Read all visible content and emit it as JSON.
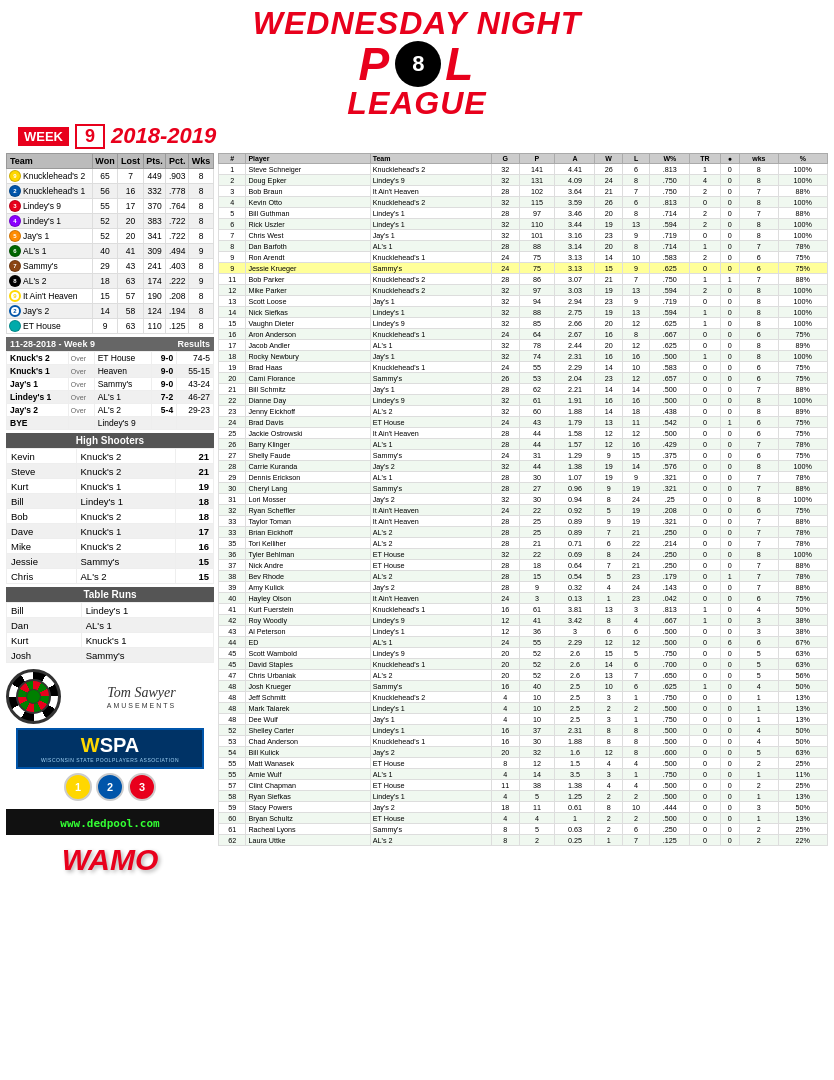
{
  "header": {
    "line1": "WEDNESDAY NIGHT",
    "line2": "P  L LEAGUE",
    "week_label": "WEEK",
    "week_num": "9",
    "year": "2018-2019"
  },
  "standings": {
    "title": "Team",
    "headers": [
      "Team",
      "Won",
      "Lost",
      "Pts.",
      "Pct.",
      "Wks"
    ],
    "rows": [
      {
        "ball_color": "#FFD700",
        "ball_num": "9",
        "solid": true,
        "team": "Knucklehead's 2",
        "won": 65,
        "lost": 7,
        "pts": 449,
        "pct": ".903",
        "wks": 8
      },
      {
        "ball_color": "#0055AA",
        "ball_num": "2",
        "solid": true,
        "team": "Knucklehead's 1",
        "won": 56,
        "lost": 16,
        "pts": 332,
        "pct": ".778",
        "wks": 8
      },
      {
        "ball_color": "#e8001c",
        "ball_num": "3",
        "solid": true,
        "team": "Lindey's 9",
        "won": 55,
        "lost": 17,
        "pts": 370,
        "pct": ".764",
        "wks": 8
      },
      {
        "ball_color": "#8B00FF",
        "ball_num": "4",
        "solid": true,
        "team": "Lindey's 1",
        "won": 52,
        "lost": 20,
        "pts": 383,
        "pct": ".722",
        "wks": 8
      },
      {
        "ball_color": "#FF8C00",
        "ball_num": "5",
        "solid": true,
        "team": "Jay's 1",
        "won": 52,
        "lost": 20,
        "pts": 341,
        "pct": ".722",
        "wks": 8
      },
      {
        "ball_color": "#006600",
        "ball_num": "6",
        "solid": true,
        "team": "AL's 1",
        "won": 40,
        "lost": 41,
        "pts": 309,
        "pct": ".494",
        "wks": 9
      },
      {
        "ball_color": "#8B4513",
        "ball_num": "7",
        "solid": true,
        "team": "Sammy's",
        "won": 29,
        "lost": 43,
        "pts": 241,
        "pct": ".403",
        "wks": 8
      },
      {
        "ball_color": "#000000",
        "ball_num": "8",
        "solid": true,
        "team": "AL's 2",
        "won": 18,
        "lost": 63,
        "pts": 174,
        "pct": ".222",
        "wks": 9
      },
      {
        "ball_color": "#FFD700",
        "ball_num": "9",
        "solid": false,
        "team": "It Ain't Heaven",
        "won": 15,
        "lost": 57,
        "pts": 190,
        "pct": ".208",
        "wks": 8
      },
      {
        "ball_color": "#0055AA",
        "ball_num": "2",
        "solid": false,
        "team": "Jay's 2",
        "won": 14,
        "lost": 58,
        "pts": 124,
        "pct": ".194",
        "wks": 8
      },
      {
        "ball_color": "#00AAAA",
        "ball_num": "",
        "solid": true,
        "team": "ET House",
        "won": 9,
        "lost": 63,
        "pts": 110,
        "pct": ".125",
        "wks": 8
      }
    ]
  },
  "week_results": {
    "title": "11-28-2018 - Week 9",
    "results_label": "Results",
    "rows": [
      {
        "team1": "Knuck's 2",
        "over": "Over",
        "team2": "ET House",
        "score1": "9-0",
        "score2": "74-5"
      },
      {
        "team1": "Knuck's 1",
        "over": "Over",
        "team2": "Heaven",
        "score1": "9-0",
        "score2": "55-15"
      },
      {
        "team1": "Jay's 1",
        "over": "Over",
        "team2": "Sammy's",
        "score1": "9-0",
        "score2": "43-24"
      },
      {
        "team1": "Lindey's 1",
        "over": "Over",
        "team2": "AL's 1",
        "score1": "7-2",
        "score2": "46-27"
      },
      {
        "team1": "Jay's 2",
        "over": "Over",
        "team2": "AL's 2",
        "score1": "5-4",
        "score2": "29-23"
      },
      {
        "team1": "BYE",
        "over": "",
        "team2": "Lindey's 9",
        "score1": "",
        "score2": ""
      }
    ]
  },
  "high_shooters": {
    "title": "High Shooters",
    "rows": [
      {
        "name": "Kevin",
        "team": "Knuck's 2",
        "score": 21
      },
      {
        "name": "Steve",
        "team": "Knuck's 2",
        "score": 21
      },
      {
        "name": "Kurt",
        "team": "Knuck's 1",
        "score": 19
      },
      {
        "name": "Bill",
        "team": "Lindey's 1",
        "score": 18
      },
      {
        "name": "Bob",
        "team": "Knuck's 2",
        "score": 18
      },
      {
        "name": "Dave",
        "team": "Knuck's 1",
        "score": 17
      },
      {
        "name": "Mike",
        "team": "Knuck's 2",
        "score": 16
      },
      {
        "name": "Jessie",
        "team": "Sammy's",
        "score": 15
      },
      {
        "name": "Chris",
        "team": "AL's 2",
        "score": 15
      }
    ]
  },
  "table_runs": {
    "title": "Table Runs",
    "rows": [
      {
        "name": "Bill",
        "team": "Lindey's 1"
      },
      {
        "name": "Dan",
        "team": "AL's 1"
      },
      {
        "name": "Kurt",
        "team": "Knuck's 1"
      },
      {
        "name": "Josh",
        "team": "Sammy's"
      }
    ]
  },
  "logos": {
    "tom_sawyer": "Tom Sawyer",
    "tom_sawyer_sub": "AMUSEMENTS",
    "wspa": "WSPA",
    "wspa_full": "WISCONSIN STATE POOLPLAYERS ASSOCIATION",
    "dedpool": "www.dedpool.com",
    "wamo": "WAMO"
  },
  "stats": {
    "headers": [
      "#",
      "Player",
      "Team",
      "G",
      "P",
      "A",
      "W",
      "L",
      "W%",
      "TR",
      "●",
      "wks",
      "%"
    ],
    "rows": [
      [
        1,
        "Steve Schneiger",
        "Knucklehead's 2",
        32,
        141,
        4.41,
        26,
        6,
        ".813",
        1,
        0,
        8,
        "100%"
      ],
      [
        2,
        "Doug Epker",
        "Lindey's 9",
        32,
        131,
        4.09,
        24,
        8,
        ".750",
        4,
        0,
        8,
        "100%"
      ],
      [
        3,
        "Bob Braun",
        "It Ain't Heaven",
        28,
        102,
        3.64,
        21,
        7,
        ".750",
        2,
        0,
        7,
        "88%"
      ],
      [
        4,
        "Kevin Otto",
        "Knucklehead's 2",
        32,
        115,
        3.59,
        26,
        6,
        ".813",
        0,
        0,
        8,
        "100%"
      ],
      [
        5,
        "Bill Guthman",
        "Lindey's 1",
        28,
        97,
        3.46,
        20,
        8,
        ".714",
        2,
        0,
        7,
        "88%"
      ],
      [
        6,
        "Rick Uszler",
        "Lindey's 1",
        32,
        110,
        3.44,
        19,
        13,
        ".594",
        2,
        0,
        8,
        "100%"
      ],
      [
        7,
        "Chris West",
        "Jay's 1",
        32,
        101,
        3.16,
        23,
        9,
        ".719",
        0,
        0,
        8,
        "100%"
      ],
      [
        8,
        "Dan Barfoth",
        "AL's 1",
        28,
        88,
        3.14,
        20,
        8,
        ".714",
        1,
        0,
        7,
        "78%"
      ],
      [
        9,
        "Ron Arendt",
        "Knucklehead's 1",
        24,
        75,
        3.13,
        14,
        10,
        ".583",
        2,
        0,
        6,
        "75%"
      ],
      [
        9,
        "Jessie Krueger",
        "Sammy's",
        24,
        75,
        3.13,
        15,
        9,
        ".625",
        0,
        0,
        6,
        "75%"
      ],
      [
        11,
        "Bob Parker",
        "Knucklehead's 2",
        28,
        86,
        3.07,
        21,
        7,
        ".750",
        1,
        1,
        7,
        "88%"
      ],
      [
        12,
        "Mike Parker",
        "Knucklehead's 2",
        32,
        97,
        3.03,
        19,
        13,
        ".594",
        2,
        0,
        8,
        "100%"
      ],
      [
        13,
        "Scott Loose",
        "Jay's 1",
        32,
        94,
        2.94,
        23,
        9,
        ".719",
        0,
        0,
        8,
        "100%"
      ],
      [
        14,
        "Nick Siefkas",
        "Lindey's 1",
        32,
        88,
        2.75,
        19,
        13,
        ".594",
        1,
        0,
        8,
        "100%"
      ],
      [
        15,
        "Vaughn Dieter",
        "Lindey's 9",
        32,
        85,
        2.66,
        20,
        12,
        ".625",
        1,
        0,
        8,
        "100%"
      ],
      [
        16,
        "Aron Anderson",
        "Knucklehead's 1",
        24,
        64,
        2.67,
        16,
        8,
        ".667",
        0,
        0,
        6,
        "75%"
      ],
      [
        17,
        "Jacob Andler",
        "AL's 1",
        32,
        78,
        2.44,
        20,
        12,
        ".625",
        0,
        0,
        8,
        "89%"
      ],
      [
        18,
        "Rocky Newbury",
        "Jay's 1",
        32,
        74,
        2.31,
        16,
        16,
        ".500",
        1,
        0,
        8,
        "100%"
      ],
      [
        19,
        "Brad Haas",
        "Knucklehead's 1",
        24,
        55,
        2.29,
        14,
        10,
        ".583",
        0,
        0,
        6,
        "75%"
      ],
      [
        20,
        "Cami Florance",
        "Sammy's",
        26,
        53,
        2.04,
        23,
        12,
        ".657",
        0,
        0,
        6,
        "75%"
      ],
      [
        21,
        "Bill Schmitz",
        "Jay's 1",
        28,
        62,
        2.21,
        14,
        14,
        ".500",
        0,
        0,
        7,
        "88%"
      ],
      [
        22,
        "Dianne Day",
        "Lindey's 9",
        32,
        61,
        1.91,
        16,
        16,
        ".500",
        0,
        0,
        8,
        "100%"
      ],
      [
        23,
        "Jenny Eickhoff",
        "AL's 2",
        32,
        60,
        1.88,
        14,
        18,
        ".438",
        0,
        0,
        8,
        "89%"
      ],
      [
        24,
        "Brad Davis",
        "ET House",
        24,
        43,
        1.79,
        13,
        11,
        ".542",
        0,
        1,
        6,
        "75%"
      ],
      [
        25,
        "Jackie Ostrowski",
        "It Ain't Heaven",
        28,
        44,
        1.58,
        12,
        12,
        ".500",
        0,
        0,
        6,
        "75%"
      ],
      [
        26,
        "Barry Klinger",
        "AL's 1",
        28,
        44,
        1.57,
        12,
        16,
        ".429",
        0,
        0,
        7,
        "78%"
      ],
      [
        27,
        "Shelly Faude",
        "Sammy's",
        24,
        31,
        1.29,
        9,
        15,
        ".375",
        0,
        0,
        6,
        "75%"
      ],
      [
        28,
        "Carrie Kuranda",
        "Jay's 2",
        32,
        44,
        1.38,
        19,
        14,
        ".576",
        0,
        0,
        8,
        "100%"
      ],
      [
        29,
        "Dennis Erickson",
        "AL's 1",
        28,
        30,
        1.07,
        19,
        9,
        ".321",
        0,
        0,
        7,
        "78%"
      ],
      [
        30,
        "Cheryl Lang",
        "Sammy's",
        28,
        27,
        0.96,
        9,
        19,
        ".321",
        0,
        0,
        7,
        "88%"
      ],
      [
        31,
        "Lori Mosser",
        "Jay's 2",
        32,
        30,
        0.94,
        8,
        24,
        ".25",
        0,
        0,
        8,
        "100%"
      ],
      [
        32,
        "Ryan Scheffler",
        "It Ain't Heaven",
        24,
        22,
        0.92,
        5,
        19,
        ".208",
        0,
        0,
        6,
        "75%"
      ],
      [
        33,
        "Taylor Toman",
        "It Ain't Heaven",
        28,
        25,
        0.89,
        9,
        19,
        ".321",
        0,
        0,
        7,
        "88%"
      ],
      [
        33,
        "Brian Eickhoff",
        "AL's 2",
        28,
        25,
        0.89,
        7,
        21,
        ".250",
        0,
        0,
        7,
        "78%"
      ],
      [
        35,
        "Tori Kelliher",
        "AL's 2",
        28,
        21,
        0.71,
        6,
        22,
        ".214",
        0,
        0,
        7,
        "78%"
      ],
      [
        36,
        "Tyler Behlman",
        "ET House",
        32,
        22,
        0.69,
        8,
        24,
        ".250",
        0,
        0,
        8,
        "100%"
      ],
      [
        37,
        "Nick Andre",
        "ET House",
        28,
        18,
        0.64,
        7,
        21,
        ".250",
        0,
        0,
        7,
        "88%"
      ],
      [
        38,
        "Bev Rhode",
        "AL's 2",
        28,
        15,
        0.54,
        5,
        23,
        ".179",
        0,
        1,
        7,
        "78%"
      ],
      [
        39,
        "Amy Kulick",
        "Jay's 2",
        28,
        9,
        0.32,
        4,
        24,
        ".143",
        0,
        0,
        7,
        "88%"
      ],
      [
        40,
        "Hayley Olson",
        "It Ain't Heaven",
        24,
        3,
        0.13,
        1,
        23,
        ".042",
        0,
        0,
        6,
        "75%"
      ],
      [
        41,
        "Kurt Fuerstein",
        "Knucklehead's 1",
        16,
        61,
        3.81,
        13,
        3,
        ".813",
        1,
        0,
        4,
        "50%"
      ],
      [
        42,
        "Roy Woodly",
        "Lindey's 9",
        12,
        41,
        3.42,
        8,
        4,
        ".667",
        1,
        0,
        3,
        "38%"
      ],
      [
        43,
        "Al Peterson",
        "Lindey's 1",
        12,
        36,
        3.0,
        6,
        6,
        ".500",
        0,
        0,
        3,
        "38%"
      ],
      [
        44,
        "ED",
        "AL's 1",
        24,
        55,
        2.29,
        12,
        12,
        ".500",
        0,
        6,
        6,
        "67%"
      ],
      [
        45,
        "Scott Wambold",
        "Lindey's 9",
        20,
        52,
        2.6,
        15,
        5,
        ".750",
        0,
        0,
        5,
        "63%"
      ],
      [
        45,
        "David Staples",
        "Knucklehead's 1",
        20,
        52,
        2.6,
        14,
        6,
        ".700",
        0,
        0,
        5,
        "63%"
      ],
      [
        47,
        "Chris Urbaniak",
        "AL's 2",
        20,
        52,
        2.6,
        13,
        7,
        ".650",
        0,
        0,
        5,
        "56%"
      ],
      [
        48,
        "Josh Krueger",
        "Sammy's",
        16,
        40,
        2.5,
        10,
        6,
        ".625",
        1,
        0,
        4,
        "50%"
      ],
      [
        48,
        "Jeff Schmitt",
        "Knucklehead's 2",
        4,
        10,
        2.5,
        3,
        1,
        ".750",
        0,
        0,
        1,
        "13%"
      ],
      [
        48,
        "Mark Talarek",
        "Lindey's 1",
        4,
        10,
        2.5,
        2,
        2,
        ".500",
        0,
        0,
        1,
        "13%"
      ],
      [
        48,
        "Dee Wulf",
        "Jay's 1",
        4,
        10,
        2.5,
        3,
        1,
        ".750",
        0,
        0,
        1,
        "13%"
      ],
      [
        52,
        "Shelley Carter",
        "Lindey's 1",
        16,
        37,
        2.31,
        8,
        8,
        ".500",
        0,
        0,
        4,
        "50%"
      ],
      [
        53,
        "Chad Anderson",
        "Knucklehead's 1",
        16,
        30,
        1.88,
        8,
        8,
        ".500",
        0,
        0,
        4,
        "50%"
      ],
      [
        54,
        "Bill Kulick",
        "Jay's 2",
        20,
        32,
        1.6,
        12,
        8,
        ".600",
        0,
        0,
        5,
        "63%"
      ],
      [
        55,
        "Matt Wanasek",
        "ET House",
        8,
        12,
        1.5,
        4,
        4,
        ".500",
        0,
        0,
        2,
        "25%"
      ],
      [
        55,
        "Arnie Wulf",
        "AL's 1",
        4,
        14,
        3.5,
        3,
        1,
        ".750",
        0,
        0,
        1,
        "11%"
      ],
      [
        57,
        "Clint Chapman",
        "ET House",
        11,
        38,
        1.38,
        4,
        4,
        ".500",
        0,
        0,
        2,
        "25%"
      ],
      [
        58,
        "Ryan Siefkas",
        "Lindey's 1",
        4,
        5,
        1.25,
        2,
        2,
        ".500",
        0,
        0,
        1,
        "13%"
      ],
      [
        59,
        "Stacy Powers",
        "Jay's 2",
        18,
        11,
        0.61,
        8,
        10,
        ".444",
        0,
        0,
        3,
        "50%"
      ],
      [
        60,
        "Bryan Schultz",
        "ET House",
        4,
        4,
        1.0,
        2,
        2,
        ".500",
        0,
        0,
        1,
        "13%"
      ],
      [
        61,
        "Racheal Lyons",
        "Sammy's",
        8,
        5,
        0.63,
        2,
        6,
        ".250",
        0,
        0,
        2,
        "25%"
      ],
      [
        62,
        "Laura Uttke",
        "AL's 2",
        8,
        2,
        0.25,
        1,
        7,
        ".125",
        0,
        0,
        2,
        "22%"
      ]
    ]
  }
}
